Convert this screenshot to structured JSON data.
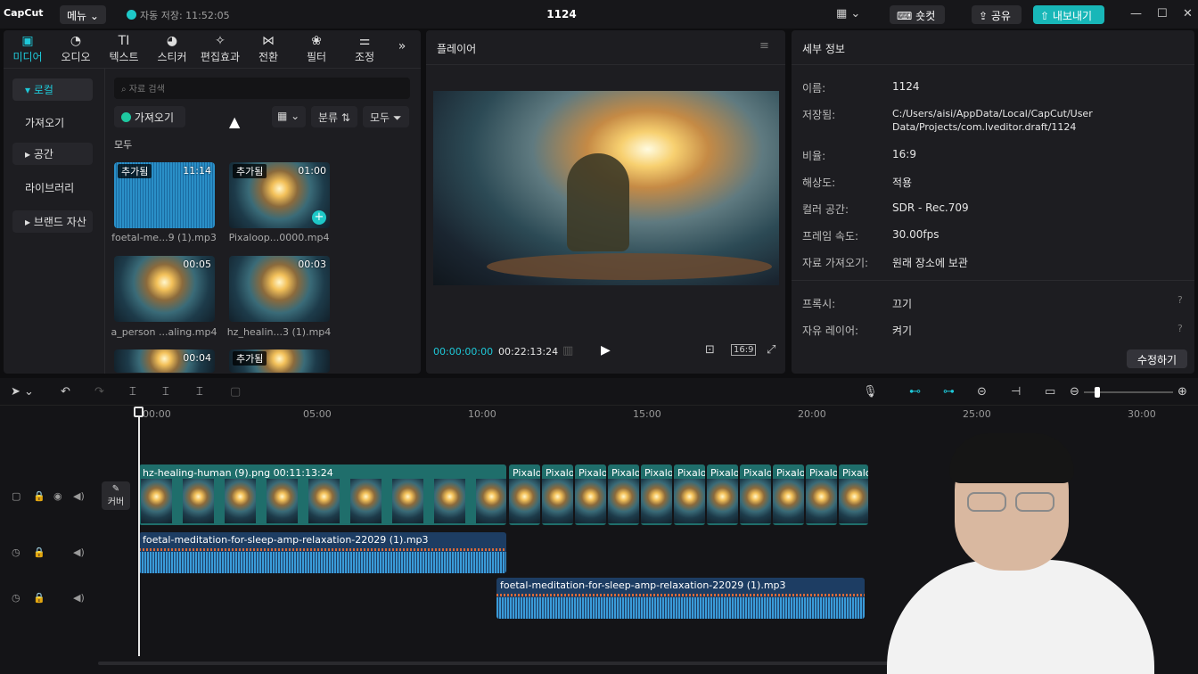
{
  "app": {
    "logo": "CapCut",
    "menu_label": "메뉴",
    "autosave": "자동 저장: 11:52:05",
    "project_name": "1124",
    "shortcut_label": "숏컷",
    "share_label": "공유",
    "export_label": "내보내기"
  },
  "media_tabs": [
    {
      "label": "미디어",
      "icon": "media-icon"
    },
    {
      "label": "오디오",
      "icon": "audio-icon"
    },
    {
      "label": "텍스트",
      "icon": "text-icon"
    },
    {
      "label": "스티커",
      "icon": "sticker-icon"
    },
    {
      "label": "편집효과",
      "icon": "effects-icon"
    },
    {
      "label": "전환",
      "icon": "transition-icon"
    },
    {
      "label": "필터",
      "icon": "filter-icon"
    },
    {
      "label": "조정",
      "icon": "adjust-icon"
    }
  ],
  "sidebar": {
    "local": "로컬",
    "import": "가져오기",
    "space": "공간",
    "library": "라이브러리",
    "brand": "브랜드 자산"
  },
  "media": {
    "search_placeholder": "자료 검색",
    "import_button": "가져오기",
    "sort_label": "분류",
    "filter_label": "모두",
    "section_all": "모두",
    "items": [
      {
        "badge": "추가됨",
        "duration": "11:14",
        "caption": "foetal-me...9 (1).mp3"
      },
      {
        "badge": "추가됨",
        "duration": "01:00",
        "caption": "Pixaloop...0000.mp4"
      },
      {
        "badge": "",
        "duration": "00:05",
        "caption": "a_person ...aling.mp4"
      },
      {
        "badge": "",
        "duration": "00:03",
        "caption": "hz_healin...3 (1).mp4"
      },
      {
        "badge": "",
        "duration": "00:04",
        "caption": ""
      },
      {
        "badge": "추가됨",
        "duration": "",
        "caption": ""
      }
    ]
  },
  "player": {
    "title": "플레이어",
    "current_time": "00:00:00:00",
    "total_time": "00:22:13:24",
    "ratio": "16:9"
  },
  "details": {
    "title": "세부 정보",
    "rows": [
      {
        "label": "이름:",
        "value": "1124"
      },
      {
        "label": "저장됨:",
        "value": "C:/Users/aisi/AppData/Local/CapCut/User Data/Projects/com.lveditor.draft/1124"
      },
      {
        "label": "비율:",
        "value": "16:9"
      },
      {
        "label": "해상도:",
        "value": "적용"
      },
      {
        "label": "컬러 공간:",
        "value": "SDR - Rec.709"
      },
      {
        "label": "프레임 속도:",
        "value": "30.00fps"
      },
      {
        "label": "자료 가져오기:",
        "value": "원래 장소에 보관"
      },
      {
        "label": "프록시:",
        "value": "끄기"
      },
      {
        "label": "자유 레이어:",
        "value": "켜기"
      }
    ],
    "edit_button": "수정하기"
  },
  "timeline": {
    "ruler": [
      "00:00",
      "05:00",
      "10:00",
      "15:00",
      "20:00",
      "25:00",
      "30:00"
    ],
    "cover_label": "커버",
    "video_clip_label": "hz-healing-human (9).png  00:11:13:24",
    "pixaloop_label": "Pixalo",
    "audio1_label": "foetal-meditation-for-sleep-amp-relaxation-22029 (1).mp3",
    "audio2_label": "foetal-meditation-for-sleep-amp-relaxation-22029 (1).mp3"
  },
  "colors": {
    "accent": "#1ec8d8",
    "export": "#18b7b8",
    "video_clip": "#1f6e6b",
    "audio_clip": "#1d3d63"
  }
}
